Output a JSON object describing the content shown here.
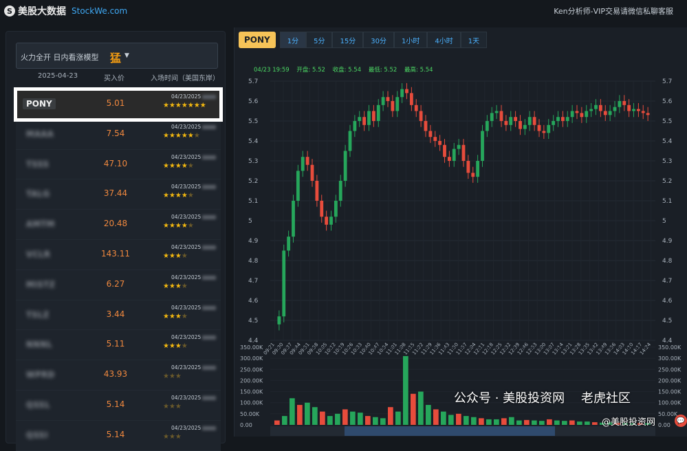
{
  "header": {
    "logo_glyph": "S",
    "app_name": "美股大数据",
    "site": "StockWe.com",
    "contact": "Ken分析师-VIP交易请微信私聊客服"
  },
  "left": {
    "model_label": "火力全开 日内看涨模型",
    "model_value": "猛",
    "col_date": "2025-04-23",
    "col_price": "买入价",
    "col_time": "入场时间（美国东岸）",
    "rows": [
      {
        "ticker": "PONY",
        "price": "5.01",
        "date": "04/23/2025",
        "stars": "★★★★★★★",
        "dim": "",
        "selected": true
      },
      {
        "ticker": "MAAA",
        "price": "7.54",
        "date": "04/23/2025",
        "stars": "★★★★★",
        "dim": "★",
        "selected": false
      },
      {
        "ticker": "TSSS",
        "price": "47.10",
        "date": "04/23/2025",
        "stars": "★★★★",
        "dim": "★",
        "selected": false
      },
      {
        "ticker": "TALG",
        "price": "37.44",
        "date": "04/23/2025",
        "stars": "★★★★",
        "dim": "★",
        "selected": false
      },
      {
        "ticker": "AMTM",
        "price": "20.48",
        "date": "04/23/2025",
        "stars": "★★★★",
        "dim": "★",
        "selected": false
      },
      {
        "ticker": "VCLR",
        "price": "143.11",
        "date": "04/23/2025",
        "stars": "★★★",
        "dim": "★",
        "selected": false
      },
      {
        "ticker": "MISTZ",
        "price": "6.27",
        "date": "04/23/2025",
        "stars": "★★★",
        "dim": "★",
        "selected": false
      },
      {
        "ticker": "TSLZ",
        "price": "3.44",
        "date": "04/23/2025",
        "stars": "★★★",
        "dim": "★",
        "selected": false
      },
      {
        "ticker": "NNNL",
        "price": "5.11",
        "date": "04/23/2025",
        "stars": "★★★",
        "dim": "★",
        "selected": false
      },
      {
        "ticker": "WPRD",
        "price": "43.93",
        "date": "04/23/2025",
        "stars": "",
        "dim": "★★★",
        "selected": false
      },
      {
        "ticker": "QSSL",
        "price": "5.14",
        "date": "04/23/2025",
        "stars": "",
        "dim": "★★★",
        "selected": false
      },
      {
        "ticker": "QSSI",
        "price": "5.14",
        "date": "04/23/2025",
        "stars": "",
        "dim": "★★★",
        "selected": false
      }
    ]
  },
  "chart": {
    "ticker": "PONY",
    "timeframes": [
      "1分",
      "5分",
      "15分",
      "30分",
      "1小时",
      "4小时",
      "1天"
    ],
    "active_timeframe": "1分",
    "ohlc": {
      "time": "04/23 19:59",
      "open": "开盘: 5.52",
      "close": "收盘: 5.54",
      "low": "最低: 5.52",
      "high": "最高: 5.54"
    }
  },
  "chart_data": {
    "type": "candlestick",
    "y_ticks": [
      "5.7",
      "5.6",
      "5.5",
      "5.4",
      "5.3",
      "5.2",
      "5.1",
      "5",
      "4.9",
      "4.8",
      "4.7",
      "4.6",
      "4.5",
      "4.4"
    ],
    "ylim": [
      4.4,
      5.7
    ],
    "x_ticks": [
      "09:21",
      "09:30",
      "09:37",
      "09:44",
      "09:51",
      "09:58",
      "10:05",
      "10:12",
      "10:19",
      "10:26",
      "10:33",
      "10:40",
      "10:47",
      "10:54",
      "11:01",
      "11:08",
      "11:15",
      "11:22",
      "11:29",
      "11:36",
      "11:43",
      "11:50",
      "11:57",
      "12:04",
      "12:11",
      "12:18",
      "12:25",
      "12:32",
      "12:39",
      "12:46",
      "12:53",
      "13:00",
      "13:07",
      "13:14",
      "13:21",
      "13:28",
      "13:35",
      "13:42",
      "13:49",
      "13:56",
      "14:03",
      "14:10",
      "14:17",
      "14:24"
    ],
    "close_path": [
      4.48,
      4.52,
      4.85,
      4.92,
      5.1,
      5.25,
      5.32,
      5.28,
      5.2,
      5.1,
      5.02,
      4.98,
      5.02,
      5.1,
      5.2,
      5.35,
      5.45,
      5.5,
      5.52,
      5.48,
      5.55,
      5.5,
      5.58,
      5.62,
      5.6,
      5.55,
      5.62,
      5.66,
      5.64,
      5.58,
      5.55,
      5.5,
      5.45,
      5.42,
      5.4,
      5.38,
      5.32,
      5.3,
      5.36,
      5.38,
      5.3,
      5.24,
      5.22,
      5.3,
      5.45,
      5.5,
      5.54,
      5.55,
      5.5,
      5.48,
      5.52,
      5.5,
      5.46,
      5.48,
      5.52,
      5.48,
      5.45,
      5.44,
      5.48,
      5.5,
      5.52,
      5.5,
      5.52,
      5.55,
      5.54,
      5.52,
      5.55,
      5.56,
      5.58,
      5.55,
      5.53,
      5.55,
      5.57,
      5.6,
      5.58,
      5.55,
      5.56,
      5.55,
      5.54,
      5.53
    ],
    "volume_ticks": [
      "350.00K",
      "300.00K",
      "250.00K",
      "200.00K",
      "150.00K",
      "100.00K",
      "50.00K",
      "0.00"
    ],
    "volume_max": 350000,
    "volumes": [
      20000,
      40000,
      120000,
      90000,
      100000,
      80000,
      60000,
      40000,
      50000,
      70000,
      60000,
      55000,
      40000,
      35000,
      30000,
      80000,
      60000,
      310000,
      140000,
      150000,
      90000,
      70000,
      60000,
      45000,
      50000,
      40000,
      35000,
      30000,
      25000,
      25000,
      30000,
      35000,
      20000,
      22000,
      20000,
      18000,
      25000,
      20000,
      18000,
      20000,
      15000,
      15000,
      12000,
      10000,
      12000,
      10000,
      9000,
      8000,
      8000,
      8000
    ]
  },
  "watermark": {
    "wechat": "公众号 · 美股投资网",
    "tiger": "老虎社区",
    "sub": "@美股投资网",
    "chat_glyph": "💬"
  },
  "colors": {
    "up": "#26a65b",
    "down": "#e74c3c",
    "accent": "#f6c358",
    "link": "#4cb2ff"
  }
}
